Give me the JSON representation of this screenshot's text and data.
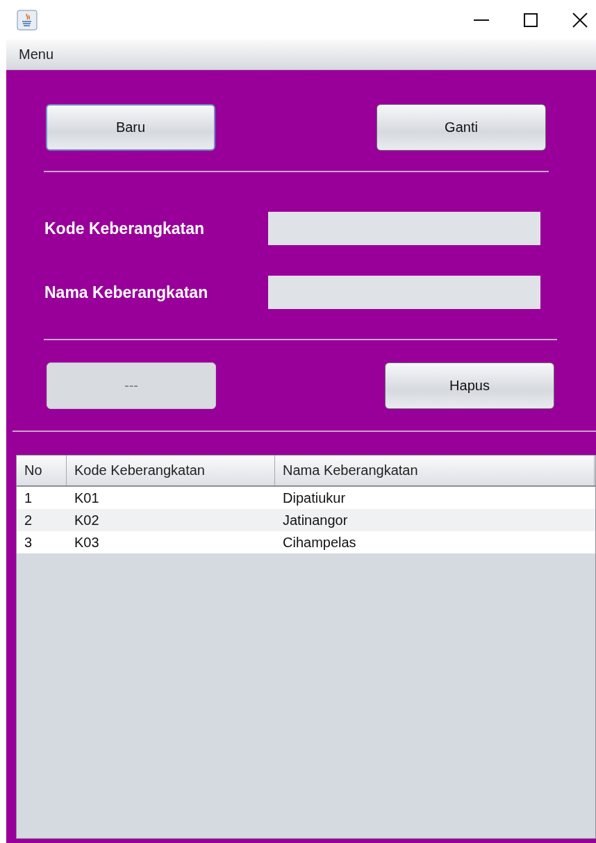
{
  "menu_bar": {
    "items": [
      "Menu"
    ]
  },
  "top_buttons": [
    {
      "label": "Baru",
      "focused": true,
      "disabled": false
    },
    {
      "label": "Ganti",
      "focused": false,
      "disabled": false
    }
  ],
  "form": {
    "fields": [
      {
        "label": "Kode Keberangkatan"
      },
      {
        "label": "Nama Keberangkatan"
      }
    ]
  },
  "bottom_buttons": [
    {
      "label": "---",
      "focused": false,
      "disabled": true
    },
    {
      "label": "Hapus",
      "focused": false,
      "disabled": false
    }
  ],
  "table": {
    "columns": [
      "No",
      "Kode Keberangkatan",
      "Nama Keberangkatan"
    ],
    "rows": [
      [
        "1",
        "K01",
        "Dipatiukur"
      ],
      [
        "2",
        "K02",
        "Jatinangor"
      ],
      [
        "3",
        "K03",
        "Cihampelas"
      ]
    ]
  }
}
